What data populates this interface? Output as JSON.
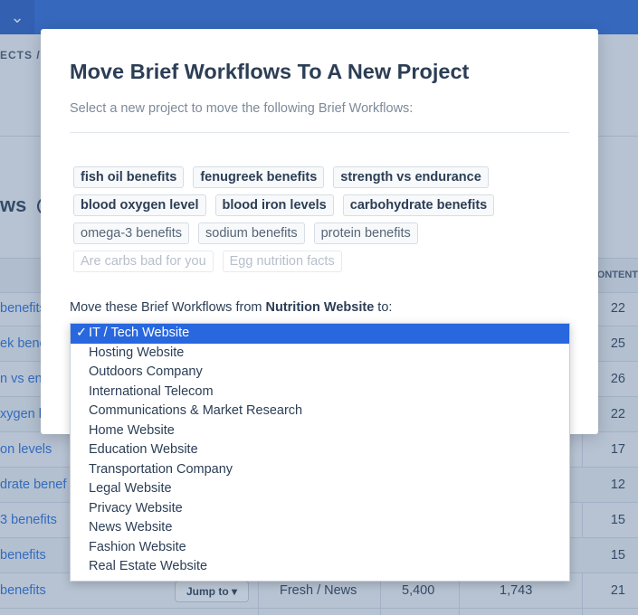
{
  "background": {
    "breadcrumb": "ECTS /",
    "section_title": "ws",
    "table_header_right": "CONTENT",
    "rows": [
      {
        "keyword": "benefits",
        "count": "22"
      },
      {
        "keyword": "ek bene",
        "count": "25"
      },
      {
        "keyword": "n vs end",
        "count": "26"
      },
      {
        "keyword": "xygen le",
        "count": "22"
      },
      {
        "keyword": "on levels",
        "count": "17"
      },
      {
        "keyword": "drate benef",
        "count": "12"
      },
      {
        "keyword": "3 benefits",
        "count": "15"
      },
      {
        "keyword": "benefits",
        "count": "15"
      },
      {
        "keyword": "benefits",
        "count": "21",
        "jump_label": "Jump to ▾",
        "category": "Fresh / News",
        "volume": "5,400",
        "words": "1,743"
      }
    ]
  },
  "modal": {
    "title": "Move Brief Workflows To A New Project",
    "subtitle": "Select a new project to move the following Brief Workflows:",
    "tags": [
      [
        "fish oil benefits",
        "fenugreek benefits",
        "strength vs endurance"
      ],
      [
        "blood oxygen level",
        "blood iron levels",
        "carbohydrate benefits"
      ],
      [
        "omega-3 benefits",
        "sodium benefits",
        "protein benefits"
      ],
      [
        "Are carbs bad for you",
        "Egg nutrition facts"
      ]
    ],
    "move_prefix": "Move these Brief Workflows from ",
    "move_source": "Nutrition Website",
    "move_suffix": " to:"
  },
  "dropdown": {
    "selected": "IT / Tech Website",
    "options": [
      "IT / Tech Website",
      "Hosting Website",
      "Outdoors Company",
      "International Telecom",
      "Communications & Market Research",
      "Home Website",
      "Education Website",
      "Transportation Company",
      "Legal Website",
      "Privacy Website",
      "News Website",
      "Fashion Website",
      "Real Estate Website"
    ]
  }
}
